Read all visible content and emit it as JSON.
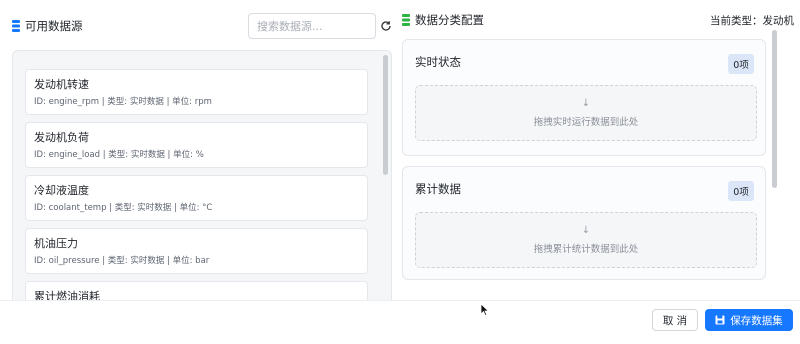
{
  "left_panel": {
    "title": "可用数据源",
    "search_placeholder": "搜索数据源...",
    "items": [
      {
        "name": "发动机转速",
        "meta": "ID: engine_rpm | 类型: 实时数据 | 单位: rpm"
      },
      {
        "name": "发动机负荷",
        "meta": "ID: engine_load | 类型: 实时数据 | 单位: %"
      },
      {
        "name": "冷却液温度",
        "meta": "ID: coolant_temp | 类型: 实时数据 | 单位: °C"
      },
      {
        "name": "机油压力",
        "meta": "ID: oil_pressure | 类型: 实时数据 | 单位: bar"
      },
      {
        "name": "累计燃油消耗",
        "meta": ""
      }
    ]
  },
  "right_panel": {
    "title": "数据分类配置",
    "current_type": "当前类型：发动机",
    "categories": [
      {
        "title": "实时状态",
        "count": "0项",
        "drop_text": "拖拽实时运行数据到此处"
      },
      {
        "title": "累计数据",
        "count": "0项",
        "drop_text": "拖拽累计统计数据到此处"
      }
    ]
  },
  "footer": {
    "cancel_label": "取 消",
    "save_label": "保存数据集"
  },
  "colors": {
    "primary": "#1677ff",
    "badge_bg": "#dbe7f8",
    "db_icon_blue": "#1677ff",
    "db_icon_green": "#2fb344"
  },
  "icons": {
    "left_title_icon": "database-icon",
    "right_title_icon": "database-icon",
    "refresh": "refresh-icon",
    "drop_arrow": "arrow-down-icon",
    "save": "save-icon"
  }
}
